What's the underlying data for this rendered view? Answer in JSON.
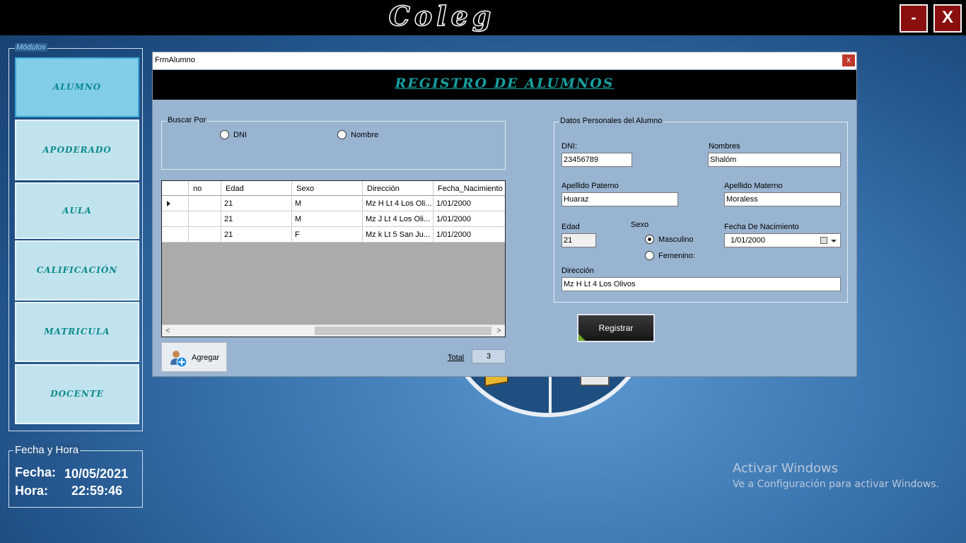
{
  "app": {
    "logo": "Coleg",
    "minimize_label": "-",
    "close_label": "X"
  },
  "modules": {
    "legend": "Módulos",
    "items": [
      {
        "label": "ALUMNO"
      },
      {
        "label": "APODERADO"
      },
      {
        "label": "AULA"
      },
      {
        "label": "CALIFICACIÓN"
      },
      {
        "label": "MATRICULA"
      },
      {
        "label": "DOCENTE"
      }
    ]
  },
  "datetime": {
    "legend": "Fecha y Hora",
    "fecha_label": "Fecha:",
    "fecha_value": "10/05/2021",
    "hora_label": "Hora:",
    "hora_value": "22:59:46"
  },
  "watermark": {
    "title": "Activar Windows",
    "subtitle": "Ve a Configuración para activar Windows."
  },
  "form": {
    "title": "FrmAlumno",
    "close_label": "x",
    "header": "REGISTRO DE ALUMNOS",
    "search": {
      "legend": "Buscar Por",
      "option_dni": "DNI",
      "option_nombre": "Nombre"
    },
    "grid": {
      "columns": [
        "no",
        "Edad",
        "Sexo",
        "Dirección",
        "Fecha_Nacimiento"
      ],
      "rows": [
        [
          "",
          "21",
          "M",
          "Mz H Lt 4 Los Oli...",
          "1/01/2000"
        ],
        [
          "",
          "21",
          "M",
          "Mz J Lt 4 Los Oli...",
          "1/01/2000"
        ],
        [
          "",
          "21",
          "F",
          "Mz k Lt 5 San Ju...",
          "1/01/2000"
        ]
      ],
      "scroll_left": "<",
      "scroll_right": ">"
    },
    "agregar_label": "Agregar",
    "total_label": "Total",
    "total_value": "3",
    "personal": {
      "legend": "Datos Personales del Alumno",
      "dni_label": "DNI:",
      "dni_value": "23456789",
      "nombres_label": "Nombres",
      "nombres_value": "Shalóm",
      "ap_paterno_label": "Apellido Paterno",
      "ap_paterno_value": "Huaraz",
      "ap_materno_label": "Apellido Materno",
      "ap_materno_value": "Moraless",
      "edad_label": "Edad",
      "edad_value": "21",
      "sexo_label": "Sexo",
      "masculino_label": "Masculino",
      "femenino_label": "Femenino:",
      "fecha_nac_label": "Fecha De Nacimiento",
      "fecha_nac_value": "1/01/2000",
      "direccion_label": "Dirección",
      "direccion_value": "Mz H Lt 4 Los Olivos"
    },
    "registrar_label": "Registrar"
  }
}
